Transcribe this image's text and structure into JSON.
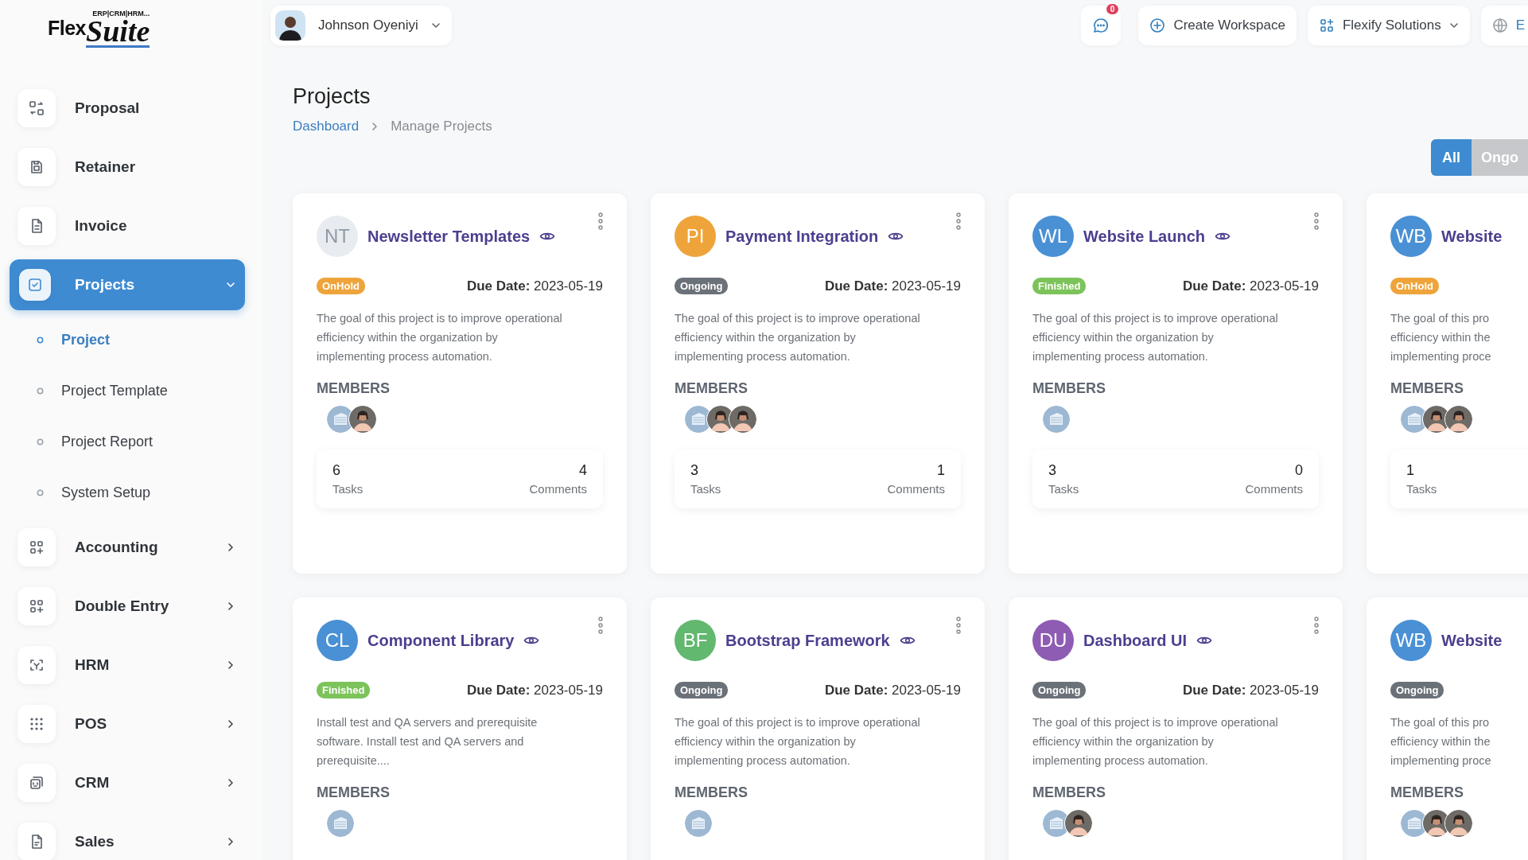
{
  "logo": {
    "word": "Flex",
    "script": "Suite",
    "tagline": "ERP|CRM|HRM..."
  },
  "sidebar": {
    "items": [
      {
        "label": "Proposal",
        "kind": "link",
        "selected": false
      },
      {
        "label": "Retainer",
        "kind": "link",
        "selected": false
      },
      {
        "label": "Invoice",
        "kind": "link",
        "selected": false
      },
      {
        "label": "Projects",
        "kind": "group",
        "selected": true,
        "expanded": true,
        "children": [
          {
            "label": "Project",
            "selected": true
          },
          {
            "label": "Project Template",
            "selected": false
          },
          {
            "label": "Project Report",
            "selected": false
          },
          {
            "label": "System Setup",
            "selected": false
          }
        ]
      },
      {
        "label": "Accounting",
        "kind": "group",
        "selected": false,
        "expanded": false
      },
      {
        "label": "Double Entry",
        "kind": "group",
        "selected": false,
        "expanded": false
      },
      {
        "label": "HRM",
        "kind": "group",
        "selected": false,
        "expanded": false
      },
      {
        "label": "POS",
        "kind": "group",
        "selected": false,
        "expanded": false
      },
      {
        "label": "CRM",
        "kind": "group",
        "selected": false,
        "expanded": false
      },
      {
        "label": "Sales",
        "kind": "group",
        "selected": false,
        "expanded": false
      }
    ]
  },
  "header": {
    "user": "Johnson Oyeniyi",
    "messages_badge": "0",
    "create_button": "Create Workspace",
    "company": "Flexify Solutions",
    "language": "E"
  },
  "page": {
    "title": "Projects",
    "breadcrumb": [
      {
        "label": "Dashboard",
        "kind": "link"
      },
      {
        "label": "Manage Projects",
        "kind": "current"
      }
    ]
  },
  "filters": [
    {
      "label": "All",
      "selected": true
    },
    {
      "label": "Ongo",
      "selected": false
    }
  ],
  "projects": [
    {
      "initials": "NT",
      "color": "#e8ecf0",
      "title": "Newsletter Templates",
      "eye": true,
      "menu": true,
      "status": {
        "label": "OnHold",
        "color": "#eea43a"
      },
      "due_label": "Due Date:",
      "due": "2023-05-19",
      "description_lines": [
        "The goal of this project is to improve operational",
        "efficiency within the organization by",
        "implementing process automation."
      ],
      "members_label": "MEMBERS",
      "members": [
        {
          "kind": "logo"
        },
        {
          "kind": "photo"
        }
      ],
      "tasks": "6",
      "tasks_label": "Tasks",
      "comments": "4",
      "comments_label": "Comments"
    },
    {
      "initials": "PI",
      "color": "#eea43a",
      "title": "Payment Integration",
      "eye": true,
      "menu": true,
      "status": {
        "label": "Ongoing",
        "color": "#6b7178"
      },
      "due_label": "Due Date:",
      "due": "2023-05-19",
      "description_lines": [
        "The goal of this project is to improve operational",
        "efficiency within the organization by",
        "implementing process automation."
      ],
      "members_label": "MEMBERS",
      "members": [
        {
          "kind": "logo"
        },
        {
          "kind": "photo"
        },
        {
          "kind": "photo"
        }
      ],
      "tasks": "3",
      "tasks_label": "Tasks",
      "comments": "1",
      "comments_label": "Comments"
    },
    {
      "initials": "WL",
      "color": "#4a90d4",
      "title": "Website Launch",
      "eye": true,
      "menu": true,
      "status": {
        "label": "Finished",
        "color": "#7cc35a"
      },
      "due_label": "Due Date:",
      "due": "2023-05-19",
      "description_lines": [
        "The goal of this project is to improve operational",
        "efficiency within the organization by",
        "implementing process automation."
      ],
      "members_label": "MEMBERS",
      "members": [
        {
          "kind": "logo"
        }
      ],
      "tasks": "3",
      "tasks_label": "Tasks",
      "comments": "0",
      "comments_label": "Comments"
    },
    {
      "initials": "WB",
      "color": "#4a90d4",
      "title": "Website",
      "eye": false,
      "menu": false,
      "status": {
        "label": "OnHold",
        "color": "#eea43a"
      },
      "description_lines": [
        "The goal of this pro",
        "efficiency within the",
        "implementing proce"
      ],
      "members_label": "MEMBERS",
      "members": [
        {
          "kind": "logo"
        },
        {
          "kind": "photo"
        },
        {
          "kind": "photo"
        }
      ],
      "tasks": "1",
      "tasks_label": "Tasks"
    },
    {
      "initials": "CL",
      "color": "#4a90d4",
      "title": "Component Library",
      "eye": true,
      "menu": true,
      "status": {
        "label": "Finished",
        "color": "#7cc35a"
      },
      "due_label": "Due Date:",
      "due": "2023-05-19",
      "description_lines": [
        "Install test and QA servers and prerequisite",
        "software. Install test and QA servers and",
        "prerequisite...."
      ],
      "members_label": "MEMBERS",
      "members": [
        {
          "kind": "logo"
        }
      ]
    },
    {
      "initials": "BF",
      "color": "#62b86e",
      "title": "Bootstrap Framework",
      "eye": true,
      "menu": true,
      "status": {
        "label": "Ongoing",
        "color": "#6b7178"
      },
      "due_label": "Due Date:",
      "due": "2023-05-19",
      "description_lines": [
        "The goal of this project is to improve operational",
        "efficiency within the organization by",
        "implementing process automation."
      ],
      "members_label": "MEMBERS",
      "members": [
        {
          "kind": "logo"
        }
      ]
    },
    {
      "initials": "DU",
      "color": "#8e5cb3",
      "title": "Dashboard UI",
      "eye": true,
      "menu": true,
      "status": {
        "label": "Ongoing",
        "color": "#6b7178"
      },
      "due_label": "Due Date:",
      "due": "2023-05-19",
      "description_lines": [
        "The goal of this project is to improve operational",
        "efficiency within the organization by",
        "implementing process automation."
      ],
      "members_label": "MEMBERS",
      "members": [
        {
          "kind": "logo"
        },
        {
          "kind": "photo"
        }
      ]
    },
    {
      "initials": "WB",
      "color": "#4a90d4",
      "title": "Website",
      "eye": false,
      "menu": false,
      "status": {
        "label": "Ongoing",
        "color": "#6b7178"
      },
      "description_lines": [
        "The goal of this pro",
        "efficiency within the",
        "implementing proce"
      ],
      "members_label": "MEMBERS",
      "members": [
        {
          "kind": "logo"
        },
        {
          "kind": "photo"
        },
        {
          "kind": "photo"
        }
      ]
    }
  ]
}
